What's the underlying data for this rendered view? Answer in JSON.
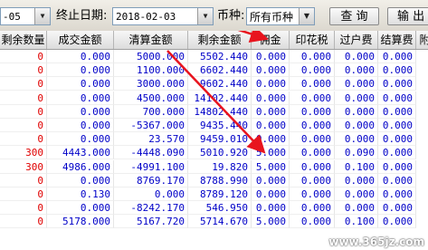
{
  "toolbar": {
    "start_date_tail": "-05",
    "end_date_label": "终止日期:",
    "end_date_value": "2018-02-03",
    "currency_label": "币种:",
    "currency_value": "所有币种",
    "query_button": "查 询",
    "export_button": "输 出"
  },
  "table": {
    "headers": [
      "剩余数量",
      "成交金额",
      "清算金额",
      "剩余金额",
      "佣金",
      "印花税",
      "过户费",
      "结算费",
      "附"
    ],
    "rows": [
      [
        "0",
        "0.000",
        "5000.000",
        "5502.440",
        "0.000",
        "0.000",
        "0.000",
        "0.000"
      ],
      [
        "0",
        "0.000",
        "1100.000",
        "6602.440",
        "0.000",
        "0.000",
        "0.000",
        "0.000"
      ],
      [
        "0",
        "0.000",
        "3000.000",
        "9602.440",
        "0.000",
        "0.000",
        "0.000",
        "0.000"
      ],
      [
        "0",
        "0.000",
        "4500.000",
        "14102.440",
        "0.000",
        "0.000",
        "0.000",
        "0.000"
      ],
      [
        "0",
        "0.000",
        "700.000",
        "14802.440",
        "0.000",
        "0.000",
        "0.000",
        "0.000"
      ],
      [
        "0",
        "0.000",
        "-5367.000",
        "9435.440",
        "0.000",
        "0.000",
        "0.000",
        "0.000"
      ],
      [
        "0",
        "0.000",
        "23.570",
        "9459.010",
        "0.000",
        "0.000",
        "0.000",
        "0.000"
      ],
      [
        "300",
        "4443.000",
        "-4448.090",
        "5010.920",
        "5.000",
        "0.000",
        "0.090",
        "0.000"
      ],
      [
        "300",
        "4986.000",
        "-4991.100",
        "19.820",
        "5.000",
        "0.000",
        "0.100",
        "0.000"
      ],
      [
        "0",
        "0.000",
        "8769.170",
        "8788.990",
        "0.000",
        "0.000",
        "0.000",
        "0.000"
      ],
      [
        "0",
        "0.130",
        "0.000",
        "8789.120",
        "0.000",
        "0.000",
        "0.000",
        "0.000"
      ],
      [
        "0",
        "0.000",
        "-8242.170",
        "546.950",
        "0.000",
        "0.000",
        "0.000",
        "0.000"
      ],
      [
        "0",
        "5178.000",
        "5167.720",
        "5714.670",
        "5.000",
        "0.000",
        "0.100",
        "0.000"
      ]
    ]
  },
  "colors": {
    "annotation_arrow": "#e8141e",
    "value_blue": "#0000c8",
    "value_red": "#e00000"
  },
  "watermark": "www.365jz.com"
}
